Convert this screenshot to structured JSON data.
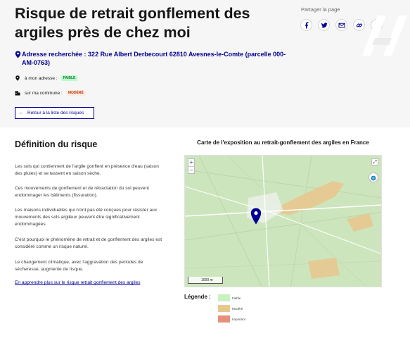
{
  "header": {
    "title": "Risque de retrait gonflement des argiles près de chez moi",
    "share_label": "Partager la page",
    "share_icons": [
      "facebook-icon",
      "twitter-icon",
      "mail-icon",
      "link-icon",
      "print-icon"
    ]
  },
  "address": {
    "text": "Adresse recherchée : 322 Rue Albert Derbecourt 62810 Avesnes-le-Comte (parcelle 000-AM-0763)"
  },
  "risks": [
    {
      "label": "à mon adresse :",
      "level": "FAIBLE",
      "color": "#18753c"
    },
    {
      "label": "sur ma commune :",
      "level": "MODÉRÉ",
      "color": "#b34000"
    }
  ],
  "back_button": "Retour à la liste des risques",
  "definition": {
    "title": "Définition du risque",
    "paragraphs": [
      "Les sols qui contiennent de l'argile gonflent en présence d'eau (saison des pluies) et se tassent en saison sèche.",
      "Ces mouvements de gonflement et de rétractation du sol peuvent endommager les bâtiments (fissuration).",
      "Les maisons individuelles qui n'ont pas été conçues pour résister aux mouvements des sols argileux peuvent être significativement endommagées.",
      "C'est pourquoi le phénomène de retrait et de gonflement des argiles est considéré comme un risque naturel.",
      "Le changement climatique, avec l'aggravation des periodes de sécheresse, augmente de risque."
    ],
    "learn_more": "En apprendre plus sur le risque retrait gonflement des argiles"
  },
  "map": {
    "title": "Carte de l'exposition au retrait-gonflement des argiles en France",
    "zoom_in": "+",
    "zoom_out": "−",
    "scale_label": "1000 m",
    "colors": {
      "faible": "#c9f0c0",
      "modere": "#e8c78e",
      "important": "#e8907a",
      "accent": "#000091"
    }
  },
  "legend": {
    "title": "Légende :",
    "items": [
      {
        "label": "Faible",
        "color": "#c9f0c0"
      },
      {
        "label": "Modéré",
        "color": "#e8c78e"
      },
      {
        "label": "Important",
        "color": "#e8907a"
      }
    ]
  }
}
